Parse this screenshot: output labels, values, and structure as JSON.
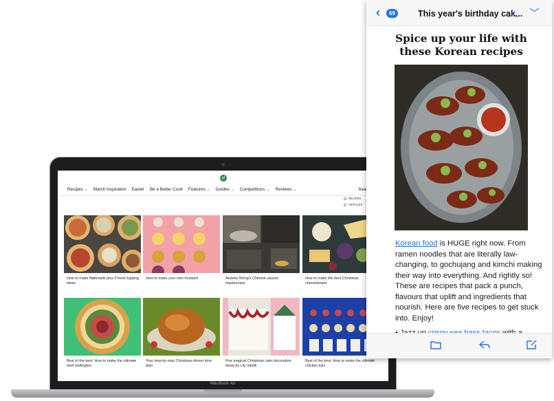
{
  "laptop": {
    "model_label": "MacBook Air",
    "site": {
      "logo_text": "gf",
      "nav": [
        "Recipes",
        "March inspiration",
        "Easter",
        "Be a Better Cook",
        "Features",
        "Guides",
        "Competitions",
        "Reviews"
      ],
      "nav_with_dropdown": [
        "Recipes",
        "Features",
        "Guides",
        "Competitions",
        "Reviews"
      ],
      "search_label": "Search",
      "filter_options": [
        "RECIPES",
        "ARTICLES"
      ],
      "cards": [
        "How to make flatbreads plus 5 fresh topping ideas",
        "How to make your own mustard",
        "Andrew Wong's Chinese sauces masterclass",
        "How to make the best Christmas cheeseboard",
        "Best of the best: How to make the ultimate beef wellington",
        "Your step-by-step Christmas dinner time plan",
        "Five magical Christmas cake decoration ideas by Lily Vanilli",
        "Best of the best: How to make the ultimate chicken kyiv"
      ]
    }
  },
  "email": {
    "unread_count": "69",
    "subject": "This year's birthday cak...",
    "heading": "Spice up your life with these Korean recipes",
    "body_link": "Korean food",
    "body_rest": " is HUGE right now. From ramen noodles that are literally law-changing, to gochujang and kimchi making their way into everything. And rightly so! These are recipes that pack a punch, flavours that uplift and ingredients that nourish. Here are five recipes to get stuck into. Enjoy!",
    "list_prefix": "Jazz up ",
    "list_link": "crispy sea bass tacos",
    "list_suffix": " with a"
  },
  "colors": {
    "accent": "#1a73e8",
    "brand_green": "#2b8a4b"
  }
}
